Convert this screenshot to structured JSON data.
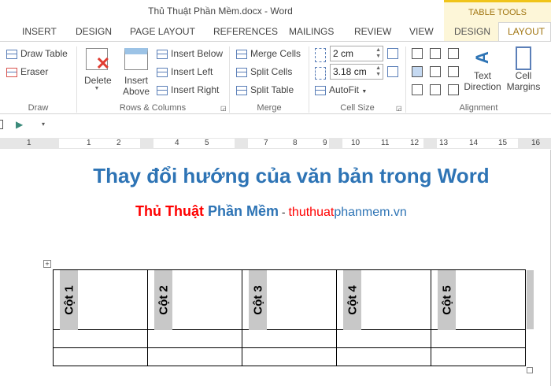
{
  "window": {
    "title": "Thủ Thuật Phần Mềm.docx - Word",
    "context_tab_group": "TABLE TOOLS"
  },
  "tabs": [
    "INSERT",
    "DESIGN",
    "PAGE LAYOUT",
    "REFERENCES",
    "MAILINGS",
    "REVIEW",
    "VIEW",
    "DESIGN",
    "LAYOUT"
  ],
  "ribbon": {
    "draw": {
      "draw_table": "Draw Table",
      "eraser": "Eraser",
      "label": "Draw"
    },
    "rows_columns": {
      "delete": "Delete",
      "insert_above_1": "Insert",
      "insert_above_2": "Above",
      "insert_below": "Insert Below",
      "insert_left": "Insert Left",
      "insert_right": "Insert Right",
      "label": "Rows & Columns"
    },
    "merge": {
      "merge_cells": "Merge Cells",
      "split_cells": "Split Cells",
      "split_table": "Split Table",
      "label": "Merge"
    },
    "cell_size": {
      "height": "2 cm",
      "width": "3.18 cm",
      "autofit": "AutoFit",
      "label": "Cell Size"
    },
    "alignment": {
      "text_direction_1": "Text",
      "text_direction_2": "Direction",
      "cell_margins_1": "Cell",
      "cell_margins_2": "Margins",
      "label": "Alignment"
    }
  },
  "ruler": [
    "1",
    "1",
    "2",
    "4",
    "5",
    "7",
    "8",
    "9",
    "10",
    "11",
    "12",
    "13",
    "14",
    "15",
    "16"
  ],
  "document": {
    "heading": "Thay đổi hướng của văn bản trong Word",
    "sub_red": "Thủ Thuật",
    "sub_blue": "Phần Mềm",
    "sub_dash": " - ",
    "site_red": "thuthuat",
    "site_blue": "phanmem.vn",
    "table_headers": [
      "Cột 1",
      "Cột 2",
      "Cột 3",
      "Cột 4",
      "Cột 5"
    ]
  },
  "colors": {
    "heading": "#2e74b5",
    "red": "#ff0000",
    "accent": "#a0740f"
  }
}
